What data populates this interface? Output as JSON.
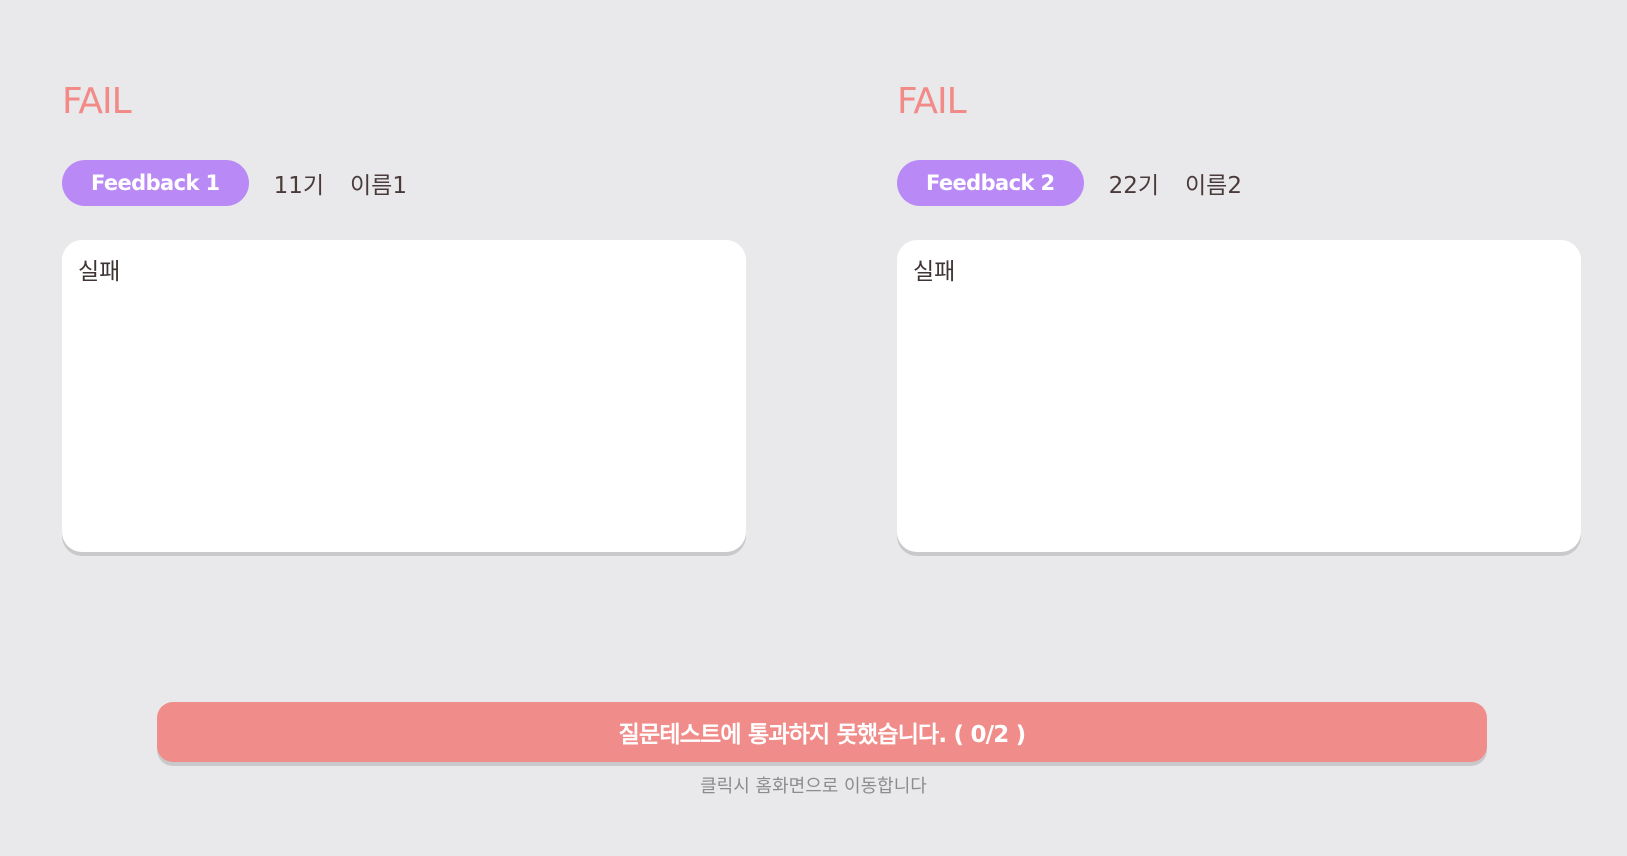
{
  "feedbacks": [
    {
      "status": "FAIL",
      "label": "Feedback 1",
      "generation": "11기",
      "name": "이름1",
      "content": "실패"
    },
    {
      "status": "FAIL",
      "label": "Feedback 2",
      "generation": "22기",
      "name": "이름2",
      "content": "실패"
    }
  ],
  "result": {
    "message": "질문테스트에 통과하지 못했습니다. ( 0/2 )",
    "hint": "클릭시 홈화면으로 이동합니다"
  },
  "colors": {
    "background": "#e9e9eb",
    "fail": "#f28b87",
    "pill": "#b98af5",
    "result_bar": "#f08c8a"
  }
}
